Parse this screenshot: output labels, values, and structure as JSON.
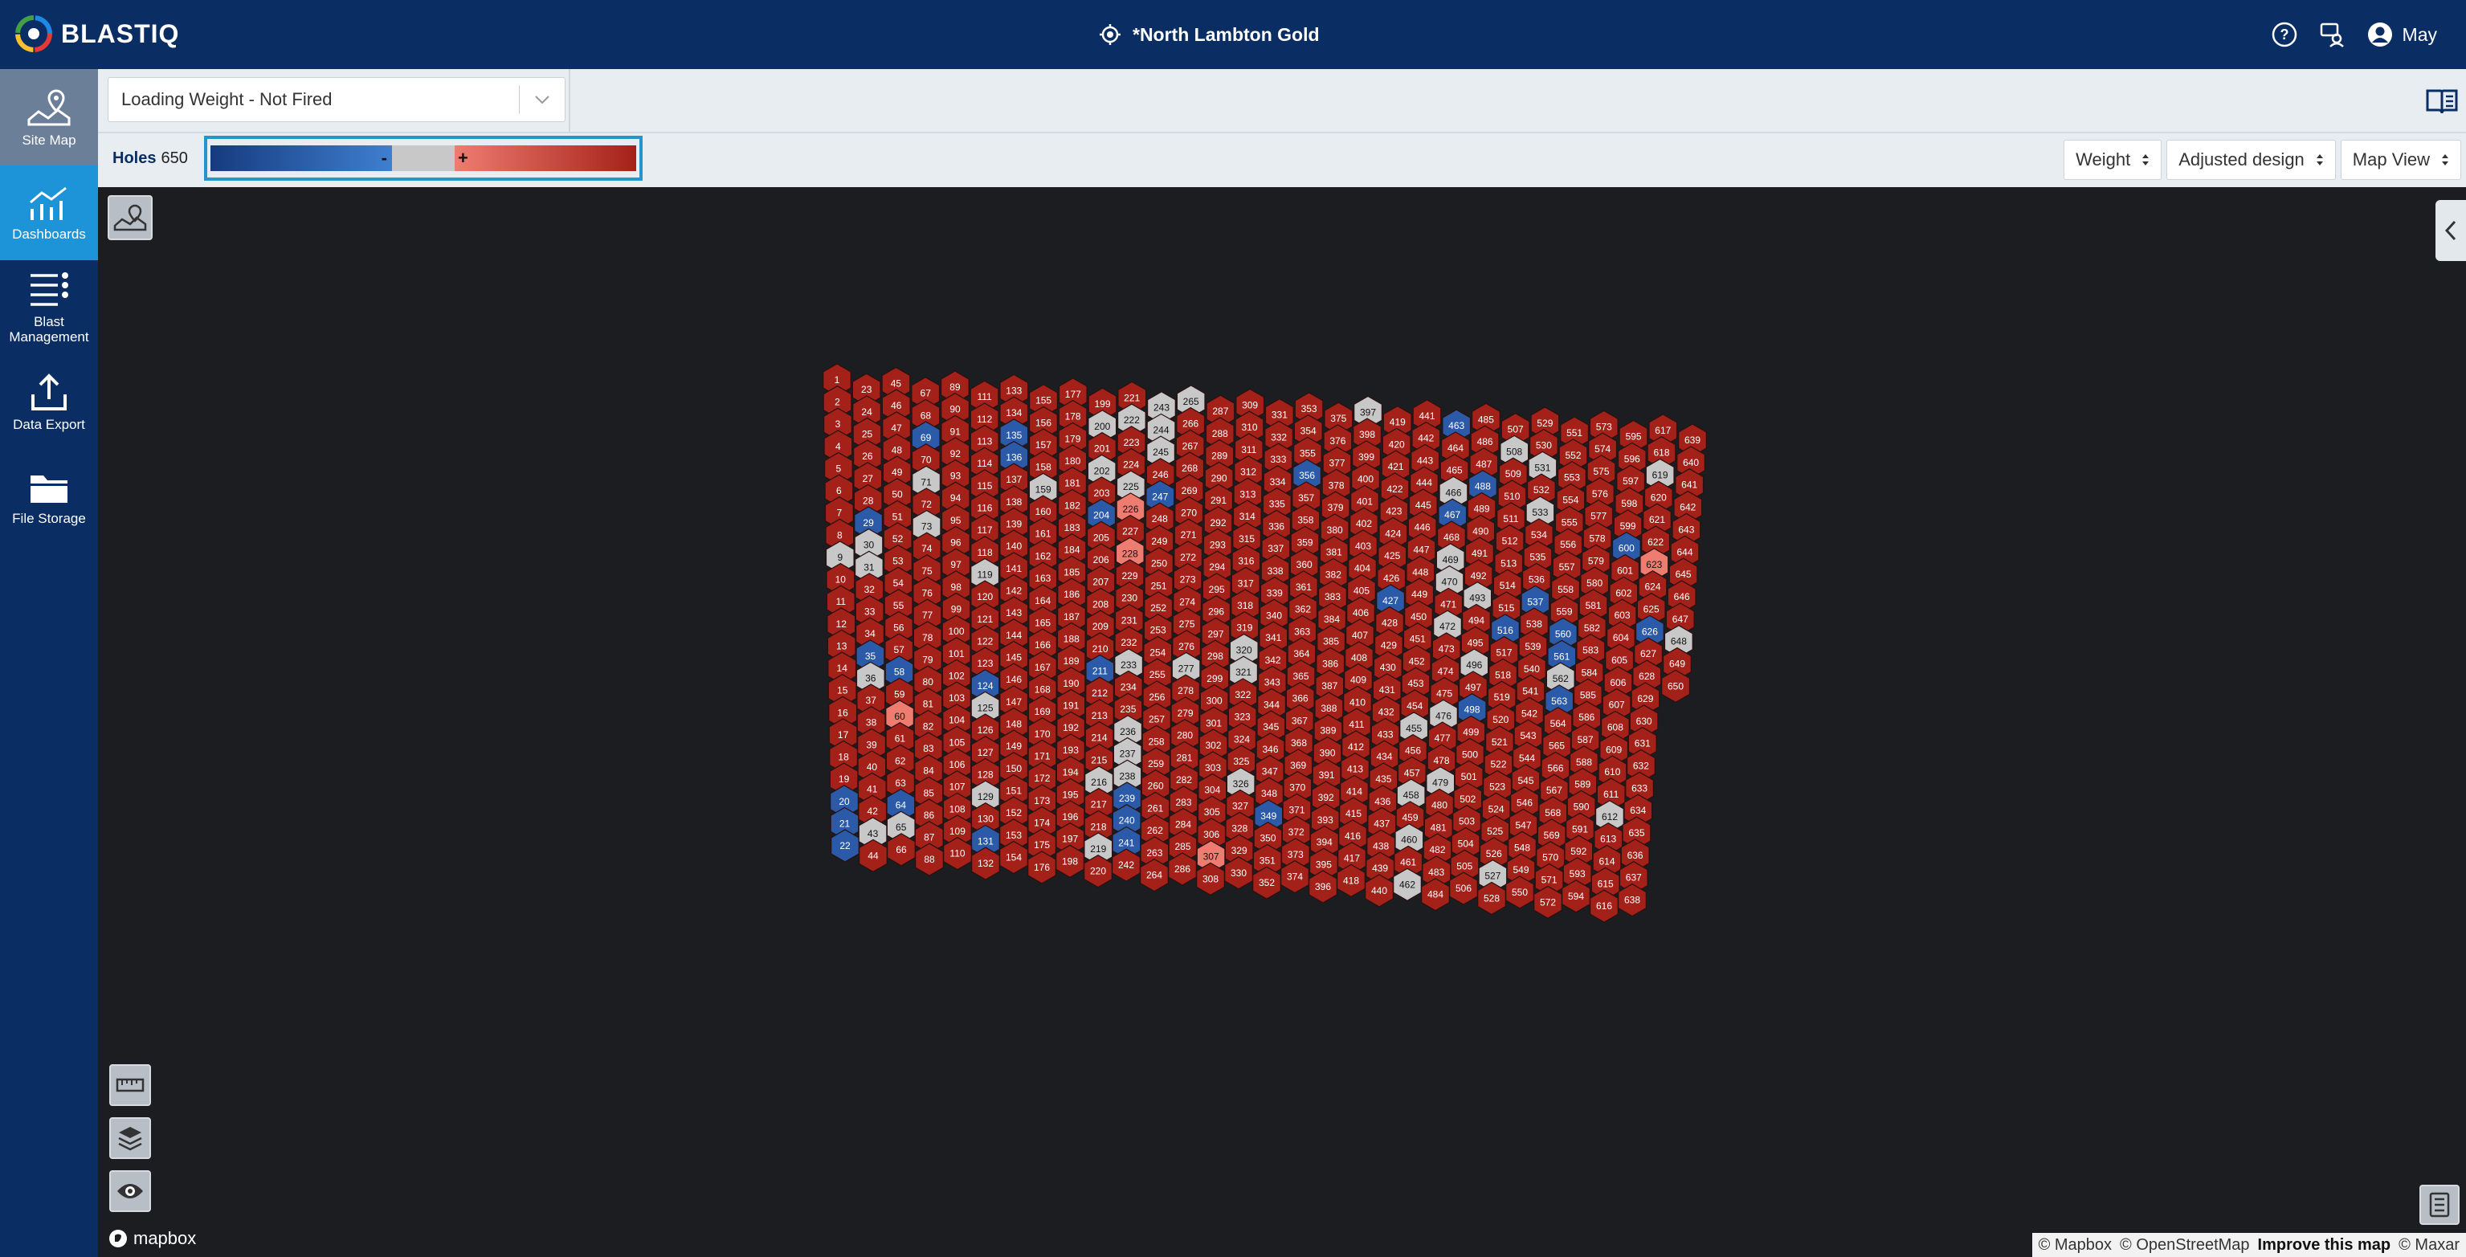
{
  "app": {
    "name": "BLASTIQ"
  },
  "header": {
    "site_name": "*North Lambton Gold",
    "user_name": "May"
  },
  "sidebar": {
    "items": [
      {
        "label": "Site Map",
        "icon": "site-map-icon"
      },
      {
        "label": "Dashboards",
        "icon": "dashboards-icon",
        "active": true
      },
      {
        "label": "Blast Management",
        "icon": "blast-management-icon"
      },
      {
        "label": "Data Export",
        "icon": "data-export-icon"
      },
      {
        "label": "File Storage",
        "icon": "file-storage-icon"
      }
    ]
  },
  "toolbar": {
    "dataset_select": "Loading Weight - Not Fired"
  },
  "legend": {
    "holes_label": "Holes",
    "holes_count": "650",
    "minus": "-",
    "plus": "+",
    "colors": {
      "low": "#163b7e",
      "neutral": "#c8c8c8",
      "high": "#a42119"
    }
  },
  "selects": {
    "metric": "Weight",
    "design": "Adjusted design",
    "view": "Map View"
  },
  "map": {
    "attribution": [
      "© Mapbox",
      "© OpenStreetMap",
      "Improve this map",
      "© Maxar"
    ],
    "brand": "mapbox"
  },
  "holes": {
    "total": 650,
    "grey_labels": [
      9,
      43,
      119,
      125,
      129,
      159,
      200,
      202,
      216,
      219,
      222,
      225,
      233,
      236,
      237,
      238,
      243,
      244,
      245,
      265,
      277,
      320,
      321,
      326,
      397,
      455,
      458,
      460,
      462,
      466,
      469,
      470,
      472,
      476,
      479,
      493,
      496,
      508,
      527,
      531,
      533,
      562,
      612,
      619,
      648,
      36,
      71,
      73,
      31,
      30,
      65
    ],
    "blue_labels": [
      21,
      22,
      35,
      58,
      124,
      131,
      135,
      136,
      204,
      211,
      239,
      240,
      241,
      247,
      349,
      356,
      427,
      463,
      467,
      488,
      498,
      516,
      537,
      560,
      561,
      563,
      600,
      626,
      64,
      69,
      20,
      29
    ],
    "light_red_labels": [
      60,
      226,
      228,
      307,
      623
    ]
  }
}
